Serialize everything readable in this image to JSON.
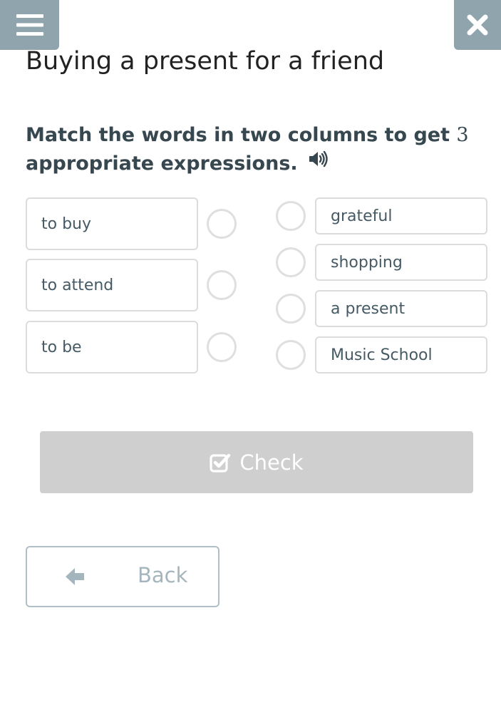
{
  "header": {
    "menu_icon": "hamburger-menu-icon",
    "close_icon": "close-icon"
  },
  "title": "Buying a present for a friend",
  "instruction": {
    "text_part1": "Match the words in two columns to get ",
    "number": "3",
    "text_part2": " appropriate expressions.",
    "audio_icon": "speaker-icon"
  },
  "left_column": [
    {
      "label": "to buy"
    },
    {
      "label": "to attend"
    },
    {
      "label": "to be"
    }
  ],
  "right_column": [
    {
      "label": "grateful"
    },
    {
      "label": "shopping"
    },
    {
      "label": "a present"
    },
    {
      "label": "Music School"
    }
  ],
  "check_button": {
    "label": "Check",
    "icon": "checkbox-check-icon",
    "state": "disabled"
  },
  "back_button": {
    "label": "Back",
    "icon": "arrow-left-icon"
  },
  "colors": {
    "header_button_bg": "#90a4ae",
    "check_button_bg": "#cfcfcf",
    "item_border": "#dcdcdc",
    "instruction_text": "#37474f"
  }
}
